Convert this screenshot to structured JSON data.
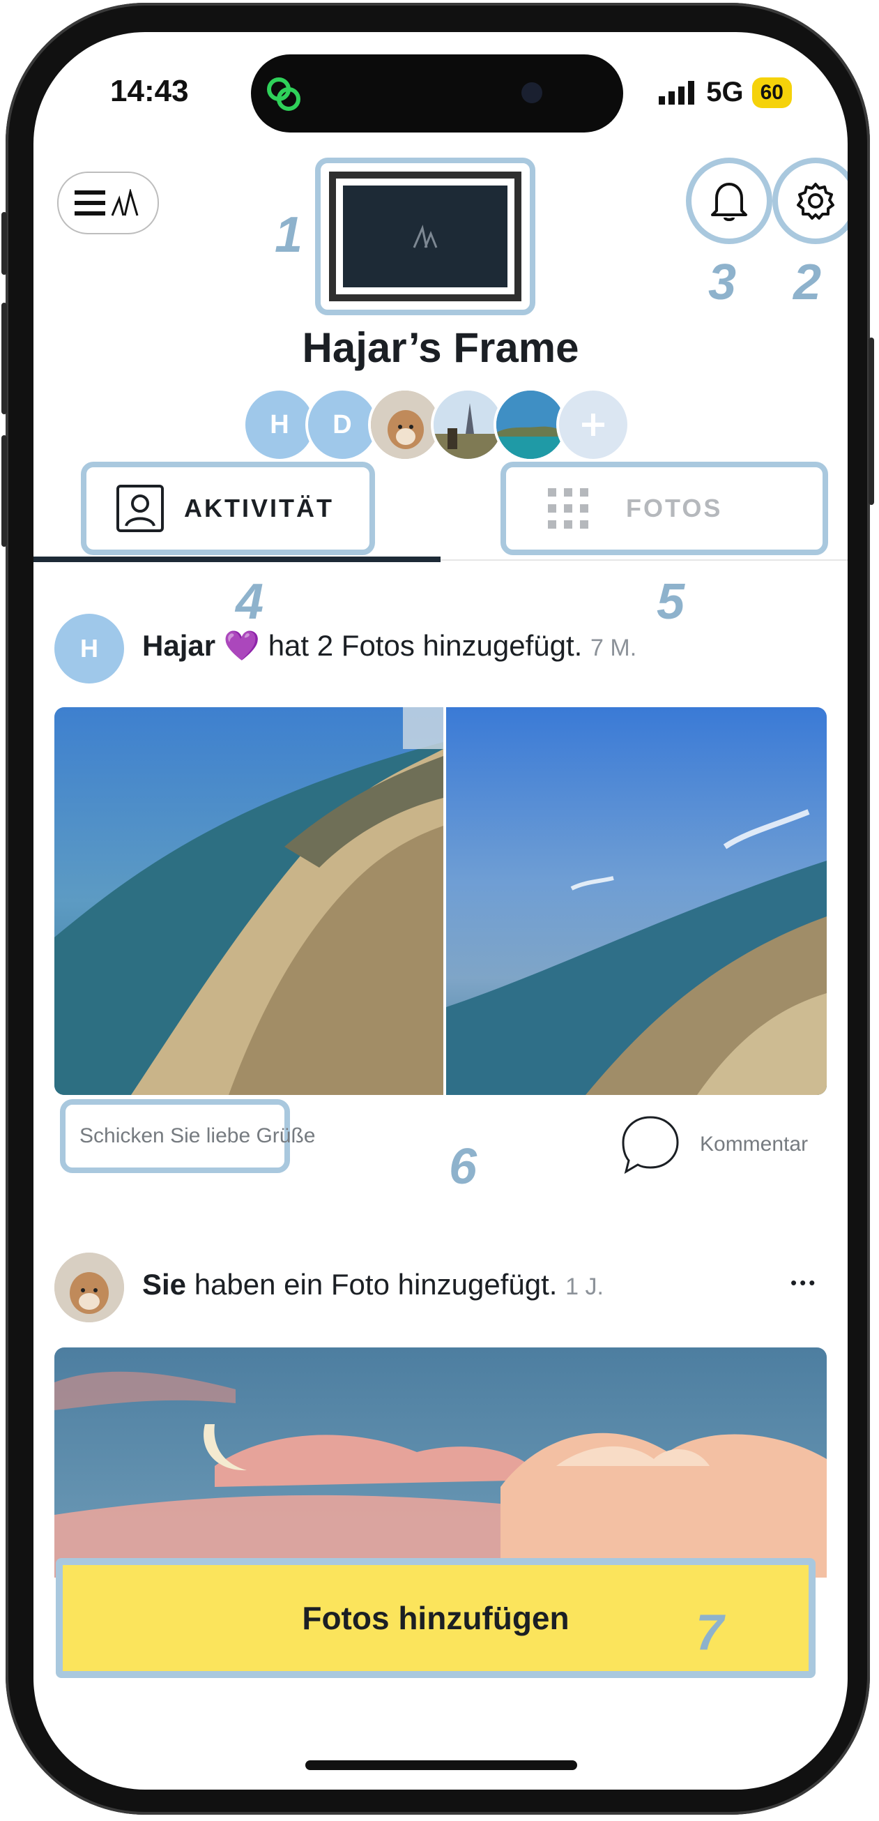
{
  "status_bar": {
    "time": "14:43",
    "network": "5G",
    "battery": "60"
  },
  "header": {
    "frame_name": "Hajar’s Frame"
  },
  "members": [
    {
      "initial": "H",
      "color": "#9fc8ea"
    },
    {
      "initial": "D",
      "color": "#9fc8ea"
    }
  ],
  "tabs": [
    {
      "label": "AKTIVITÄT",
      "active": true
    },
    {
      "label": "FOTOS",
      "active": false
    }
  ],
  "annotations": [
    "1",
    "2",
    "3",
    "4",
    "5",
    "6",
    "7"
  ],
  "feed": [
    {
      "author": "Hajar",
      "emoji": "💜",
      "text": "hat 2 Fotos hinzugefügt.",
      "time": "7 M.",
      "author_initial": "H",
      "send_love": "Schicken Sie liebe Grüße",
      "comment": "Kommentar"
    },
    {
      "author": "Sie",
      "text": "haben ein Foto hinzugefügt.",
      "time": "1 J.",
      "more": "•••"
    }
  ],
  "cta": {
    "label": "Fotos hinzufügen"
  },
  "colors": {
    "accent_blue": "#a9c8de",
    "cta_yellow": "#fbe45c",
    "avatar_blue": "#9fc8ea"
  }
}
